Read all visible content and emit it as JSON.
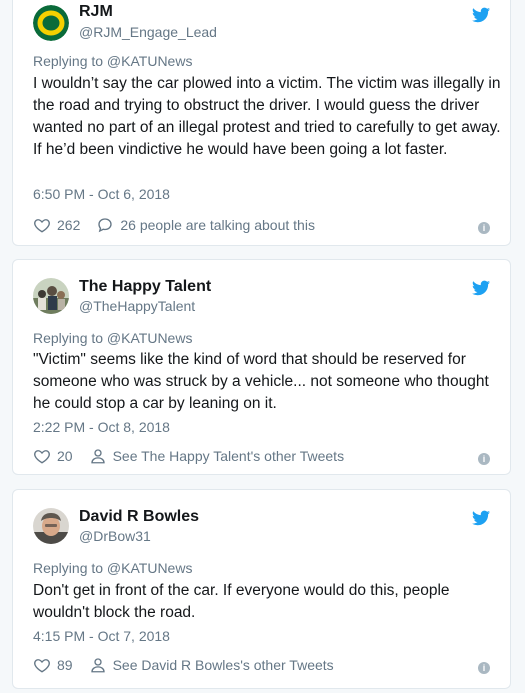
{
  "colors": {
    "twitter_blue": "#1da1f2",
    "gray": "#657786",
    "oregon_green": "#0a6b3a",
    "oregon_yellow": "#f5d000"
  },
  "tweets": [
    {
      "name": "RJM",
      "handle": "@RJM_Engage_Lead",
      "replying_to": "Replying to @KATUNews",
      "text": "I wouldn’t say the car plowed into a victim.  The victim was illegally in the road and trying to obstruct the driver. I would guess the driver wanted no part of an illegal protest and tried to carefully to get away. If he’d been vindictive he would have been going a lot faster.",
      "time": "6:50 PM - Oct 6, 2018",
      "likes": "262",
      "secondary": "26 people are talking about this",
      "secondary_icon": "comment-icon"
    },
    {
      "name": "The Happy Talent",
      "handle": "@TheHappyTalent",
      "replying_to": "Replying to @KATUNews",
      "text": "\"Victim\" seems like the kind of word that should be reserved for someone who was struck by a vehicle... not someone who thought he could stop a car by leaning on it.",
      "time": "2:22 PM - Oct 8, 2018",
      "likes": "20",
      "secondary": "See The Happy Talent's other Tweets",
      "secondary_icon": "person-icon"
    },
    {
      "name": "David R Bowles",
      "handle": "@DrBow31",
      "replying_to": "Replying to @KATUNews",
      "text": "Don't get in front of the car. If everyone would do this, people wouldn't block the road.",
      "time": "4:15 PM - Oct 7, 2018",
      "likes": "89",
      "secondary": "See David R Bowles's other Tweets",
      "secondary_icon": "person-icon"
    }
  ]
}
